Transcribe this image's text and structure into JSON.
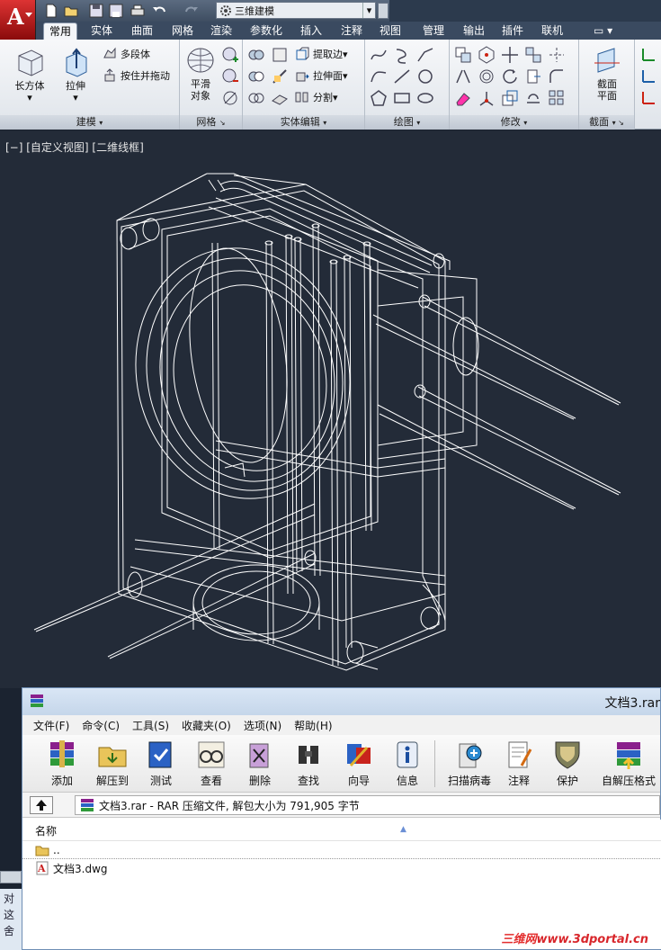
{
  "quick_access": {
    "workspace": "三维建模"
  },
  "ribbon_tabs": [
    "常用",
    "实体",
    "曲面",
    "网格",
    "渲染",
    "参数化",
    "插入",
    "注释",
    "视图",
    "管理",
    "输出",
    "插件",
    "联机"
  ],
  "ribbon": {
    "modeling": {
      "title": "建模",
      "box": "长方体",
      "extrude": "拉伸",
      "polysolid": "多段体",
      "presspull": "按住并拖动"
    },
    "mesh": {
      "title": "网格",
      "smooth_object_line1": "平滑",
      "smooth_object_line2": "对象"
    },
    "solid_edit": {
      "title": "实体编辑",
      "extract_edges": "提取边",
      "extrude_faces": "拉伸面",
      "separate": "分割"
    },
    "draw": {
      "title": "绘图"
    },
    "modify": {
      "title": "修改"
    },
    "section": {
      "title": "截面",
      "plane_line1": "截面",
      "plane_line2": "平面"
    }
  },
  "viewport": {
    "label": "[−] [自定义视图] [二维线框]"
  },
  "rar": {
    "title": "文档3.rar",
    "menu": [
      "文件(F)",
      "命令(C)",
      "工具(S)",
      "收藏夹(O)",
      "选项(N)",
      "帮助(H)"
    ],
    "toolbar": [
      "添加",
      "解压到",
      "测试",
      "查看",
      "删除",
      "查找",
      "向导",
      "信息",
      "扫描病毒",
      "注释",
      "保护",
      "自解压格式"
    ],
    "address": "文档3.rar - RAR 压缩文件, 解包大小为 791,905 字节",
    "column_name": "名称",
    "files": [
      {
        "name": ".."
      },
      {
        "name": "文档3.dwg"
      }
    ]
  },
  "bg_window_chars": [
    "对",
    "这",
    "舍"
  ],
  "watermark": {
    "cn": "三维网",
    "url": "www.3dportal.cn"
  },
  "colors": {
    "viewport_bg": "#232b38",
    "wire": "#ffffff",
    "autocad_red": "#c81e1e",
    "ribbon_tab_bar": "#3a4a60"
  }
}
